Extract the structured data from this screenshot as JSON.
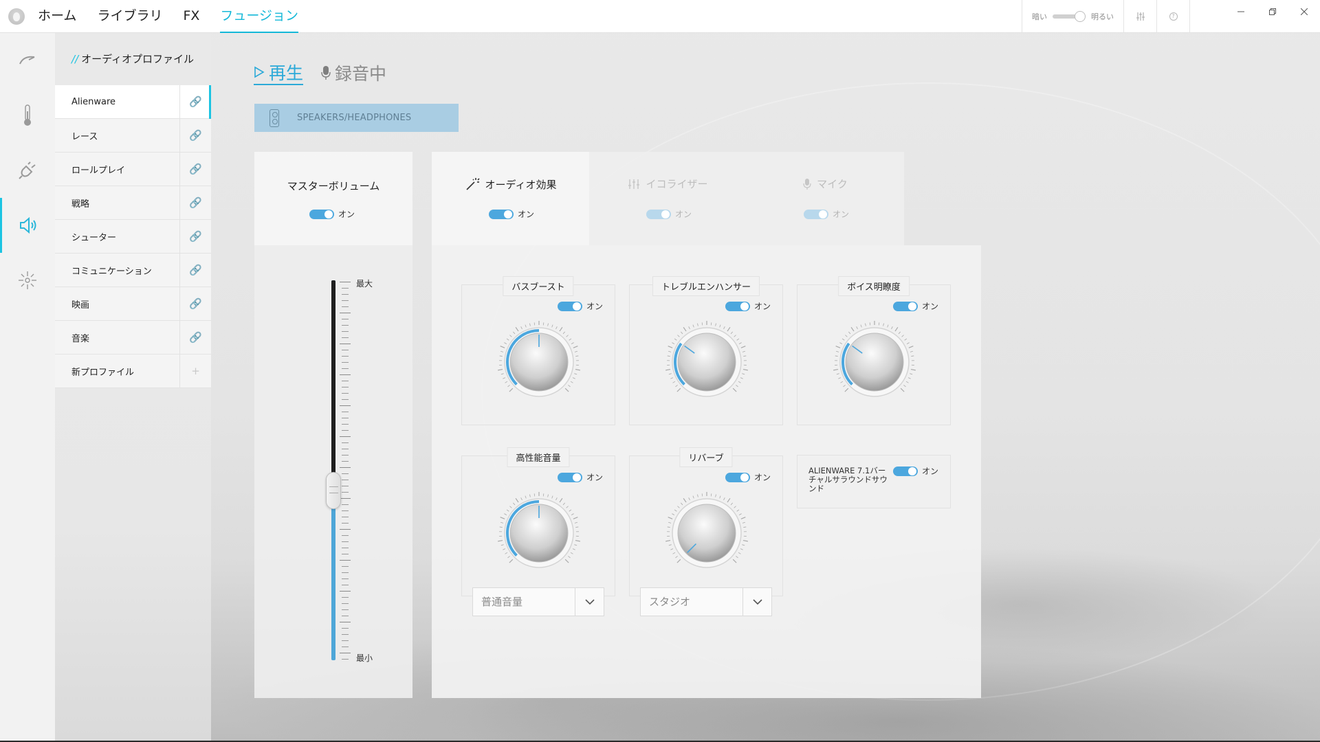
{
  "nav": {
    "items": [
      "ホーム",
      "ライブラリ",
      "FX",
      "フュージョン"
    ],
    "active_index": 3
  },
  "topbar": {
    "brightness_dark": "暗い",
    "brightness_light": "明るい",
    "brightness_level": "light",
    "icons": [
      "alienware-logo-icon",
      "sliders-icon",
      "help-icon",
      "minimize-icon",
      "restore-icon",
      "close-icon"
    ]
  },
  "rail": {
    "icons": [
      "performance-icon",
      "thermal-icon",
      "power-icon",
      "audio-icon",
      "lighting-icon"
    ],
    "active_index": 3
  },
  "profiles": {
    "title_prefix": "//",
    "title": "オーディオプロファイル",
    "items": [
      {
        "label": "Alienware",
        "icon": "link-icon"
      },
      {
        "label": "レース",
        "icon": "link-icon"
      },
      {
        "label": "ロールプレイ",
        "icon": "link-icon"
      },
      {
        "label": "戦略",
        "icon": "link-icon"
      },
      {
        "label": "シューター",
        "icon": "link-icon"
      },
      {
        "label": "コミュニケーション",
        "icon": "link-icon"
      },
      {
        "label": "映画",
        "icon": "link-icon"
      },
      {
        "label": "音楽",
        "icon": "link-icon"
      },
      {
        "label": "新プロファイル",
        "icon": "plus-icon"
      }
    ],
    "active_index": 0
  },
  "modes": {
    "playback": "再生",
    "recording": "録音中",
    "active": "playback"
  },
  "device": {
    "label": "SPEAKERS/HEADPHONES"
  },
  "master_volume": {
    "title": "マスターボリューム",
    "toggle_label": "オン",
    "toggle_on": true,
    "max_label": "最大",
    "min_label": "最小",
    "level": 0.52
  },
  "fx_tabs": {
    "audio_effects": {
      "title": "オーディオ効果",
      "toggle_label": "オン",
      "active": true
    },
    "equalizer": {
      "title": "イコライザー",
      "toggle_label": "オン",
      "active": false
    },
    "mic": {
      "title": "マイク",
      "toggle_label": "オン",
      "active": false
    }
  },
  "effects": {
    "bass_boost": {
      "title": "バスブースト",
      "toggle_label": "オン",
      "level": 0.5
    },
    "treble_enhancer": {
      "title": "トレブルエンハンサー",
      "toggle_label": "オン",
      "level": 0.3
    },
    "voice_clarity": {
      "title": "ボイス明瞭度",
      "toggle_label": "オン",
      "level": 0.3
    },
    "loudness": {
      "title": "高性能音量",
      "toggle_label": "オン",
      "level": 0.5,
      "dropdown_value": "普通音量"
    },
    "reverb": {
      "title": "リバーブ",
      "toggle_label": "オン",
      "level": 0.0,
      "dropdown_value": "スタジオ"
    },
    "surround": {
      "label": "ALIENWARE 7.1バーチャルサラウンドサウンド",
      "toggle_label": "オン"
    }
  },
  "colors": {
    "accent": "#14b8d8",
    "toggle_on": "#4ca7de",
    "device_bg": "#a9cde3",
    "knob_arc": "#4ca7de"
  }
}
